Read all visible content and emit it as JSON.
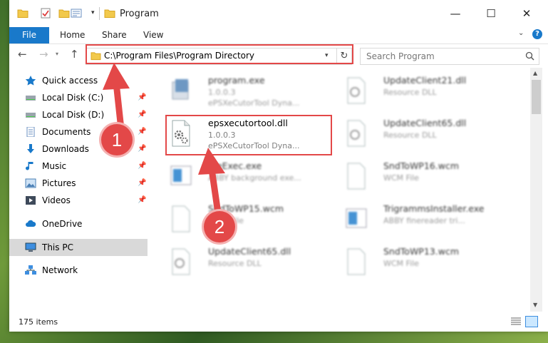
{
  "window": {
    "title": "Program",
    "minimize": "—",
    "maximize": "☐",
    "close": "✕"
  },
  "ribbon": {
    "tabs": [
      "File",
      "Home",
      "Share",
      "View"
    ],
    "help": "?"
  },
  "navbar": {
    "address": "C:\\Program Files\\Program Directory",
    "search_placeholder": "Search Program"
  },
  "sidebar": {
    "items": [
      {
        "label": "Quick access",
        "icon": "star-icon",
        "pinned": false
      },
      {
        "label": "Local Disk (C:)",
        "icon": "drive-icon",
        "pinned": true
      },
      {
        "label": "Local Disk (D:)",
        "icon": "drive-icon",
        "pinned": true
      },
      {
        "label": "Documents",
        "icon": "documents-icon",
        "pinned": true
      },
      {
        "label": "Downloads",
        "icon": "download-icon",
        "pinned": true
      },
      {
        "label": "Music",
        "icon": "music-icon",
        "pinned": true
      },
      {
        "label": "Pictures",
        "icon": "pictures-icon",
        "pinned": true
      },
      {
        "label": "Videos",
        "icon": "videos-icon",
        "pinned": true
      },
      {
        "label": "OneDrive",
        "icon": "cloud-icon",
        "pinned": false
      },
      {
        "label": "This PC",
        "icon": "computer-icon",
        "pinned": false
      },
      {
        "label": "Network",
        "icon": "network-icon",
        "pinned": false
      }
    ]
  },
  "files": [
    {
      "name": "program.exe",
      "line2": "1.0.0.3",
      "line3": "ePSXeCutorTool Dyna..."
    },
    {
      "name": "UpdateClient21.dll",
      "line2": "Resource DLL",
      "line3": ""
    },
    {
      "name": "epsxecutortool.dll",
      "line2": "1.0.0.3",
      "line3": "ePSXeCutorTool Dyna..."
    },
    {
      "name": "UpdateClient65.dll",
      "line2": "Resource DLL",
      "line3": ""
    },
    {
      "name": "...eExec.exe",
      "line2": "ABBY background exe...",
      "line3": ""
    },
    {
      "name": "SndToWP16.wcm",
      "line2": "WCM File",
      "line3": ""
    },
    {
      "name": "SndToWP15.wcm",
      "line2": "WCM File",
      "line3": ""
    },
    {
      "name": "TrigrammsInstaller.exe",
      "line2": "ABBY finereader tri...",
      "line3": ""
    },
    {
      "name": "UpdateClient65.dll",
      "line2": "Resource DLL",
      "line3": ""
    },
    {
      "name": "SndToWP13.wcm",
      "line2": "WCM File",
      "line3": ""
    }
  ],
  "status": {
    "count": "175 items"
  },
  "annotations": {
    "step1": "1",
    "step2": "2"
  },
  "colors": {
    "accent": "#1979ca",
    "highlight": "#e34848",
    "selection": "#cce8ff"
  }
}
